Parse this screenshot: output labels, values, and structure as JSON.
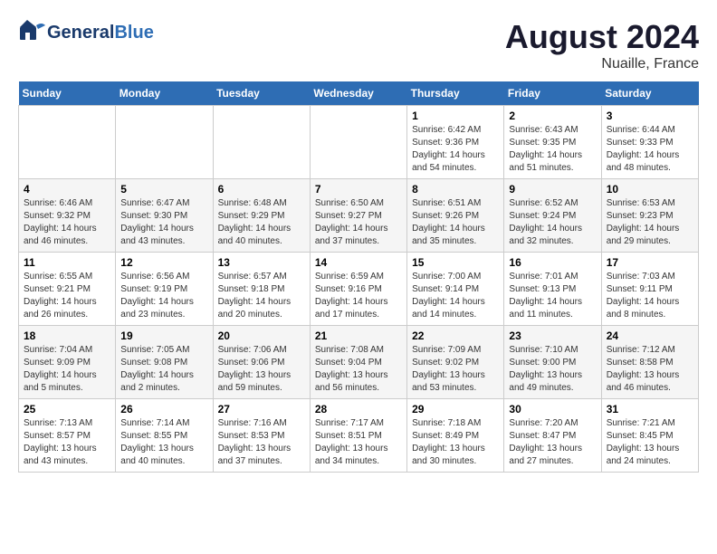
{
  "header": {
    "logo_line1": "General",
    "logo_line2": "Blue",
    "title": "August 2024",
    "location": "Nuaille, France"
  },
  "days_of_week": [
    "Sunday",
    "Monday",
    "Tuesday",
    "Wednesday",
    "Thursday",
    "Friday",
    "Saturday"
  ],
  "weeks": [
    [
      {
        "day": "",
        "info": ""
      },
      {
        "day": "",
        "info": ""
      },
      {
        "day": "",
        "info": ""
      },
      {
        "day": "",
        "info": ""
      },
      {
        "day": "1",
        "info": "Sunrise: 6:42 AM\nSunset: 9:36 PM\nDaylight: 14 hours\nand 54 minutes."
      },
      {
        "day": "2",
        "info": "Sunrise: 6:43 AM\nSunset: 9:35 PM\nDaylight: 14 hours\nand 51 minutes."
      },
      {
        "day": "3",
        "info": "Sunrise: 6:44 AM\nSunset: 9:33 PM\nDaylight: 14 hours\nand 48 minutes."
      }
    ],
    [
      {
        "day": "4",
        "info": "Sunrise: 6:46 AM\nSunset: 9:32 PM\nDaylight: 14 hours\nand 46 minutes."
      },
      {
        "day": "5",
        "info": "Sunrise: 6:47 AM\nSunset: 9:30 PM\nDaylight: 14 hours\nand 43 minutes."
      },
      {
        "day": "6",
        "info": "Sunrise: 6:48 AM\nSunset: 9:29 PM\nDaylight: 14 hours\nand 40 minutes."
      },
      {
        "day": "7",
        "info": "Sunrise: 6:50 AM\nSunset: 9:27 PM\nDaylight: 14 hours\nand 37 minutes."
      },
      {
        "day": "8",
        "info": "Sunrise: 6:51 AM\nSunset: 9:26 PM\nDaylight: 14 hours\nand 35 minutes."
      },
      {
        "day": "9",
        "info": "Sunrise: 6:52 AM\nSunset: 9:24 PM\nDaylight: 14 hours\nand 32 minutes."
      },
      {
        "day": "10",
        "info": "Sunrise: 6:53 AM\nSunset: 9:23 PM\nDaylight: 14 hours\nand 29 minutes."
      }
    ],
    [
      {
        "day": "11",
        "info": "Sunrise: 6:55 AM\nSunset: 9:21 PM\nDaylight: 14 hours\nand 26 minutes."
      },
      {
        "day": "12",
        "info": "Sunrise: 6:56 AM\nSunset: 9:19 PM\nDaylight: 14 hours\nand 23 minutes."
      },
      {
        "day": "13",
        "info": "Sunrise: 6:57 AM\nSunset: 9:18 PM\nDaylight: 14 hours\nand 20 minutes."
      },
      {
        "day": "14",
        "info": "Sunrise: 6:59 AM\nSunset: 9:16 PM\nDaylight: 14 hours\nand 17 minutes."
      },
      {
        "day": "15",
        "info": "Sunrise: 7:00 AM\nSunset: 9:14 PM\nDaylight: 14 hours\nand 14 minutes."
      },
      {
        "day": "16",
        "info": "Sunrise: 7:01 AM\nSunset: 9:13 PM\nDaylight: 14 hours\nand 11 minutes."
      },
      {
        "day": "17",
        "info": "Sunrise: 7:03 AM\nSunset: 9:11 PM\nDaylight: 14 hours\nand 8 minutes."
      }
    ],
    [
      {
        "day": "18",
        "info": "Sunrise: 7:04 AM\nSunset: 9:09 PM\nDaylight: 14 hours\nand 5 minutes."
      },
      {
        "day": "19",
        "info": "Sunrise: 7:05 AM\nSunset: 9:08 PM\nDaylight: 14 hours\nand 2 minutes."
      },
      {
        "day": "20",
        "info": "Sunrise: 7:06 AM\nSunset: 9:06 PM\nDaylight: 13 hours\nand 59 minutes."
      },
      {
        "day": "21",
        "info": "Sunrise: 7:08 AM\nSunset: 9:04 PM\nDaylight: 13 hours\nand 56 minutes."
      },
      {
        "day": "22",
        "info": "Sunrise: 7:09 AM\nSunset: 9:02 PM\nDaylight: 13 hours\nand 53 minutes."
      },
      {
        "day": "23",
        "info": "Sunrise: 7:10 AM\nSunset: 9:00 PM\nDaylight: 13 hours\nand 49 minutes."
      },
      {
        "day": "24",
        "info": "Sunrise: 7:12 AM\nSunset: 8:58 PM\nDaylight: 13 hours\nand 46 minutes."
      }
    ],
    [
      {
        "day": "25",
        "info": "Sunrise: 7:13 AM\nSunset: 8:57 PM\nDaylight: 13 hours\nand 43 minutes."
      },
      {
        "day": "26",
        "info": "Sunrise: 7:14 AM\nSunset: 8:55 PM\nDaylight: 13 hours\nand 40 minutes."
      },
      {
        "day": "27",
        "info": "Sunrise: 7:16 AM\nSunset: 8:53 PM\nDaylight: 13 hours\nand 37 minutes."
      },
      {
        "day": "28",
        "info": "Sunrise: 7:17 AM\nSunset: 8:51 PM\nDaylight: 13 hours\nand 34 minutes."
      },
      {
        "day": "29",
        "info": "Sunrise: 7:18 AM\nSunset: 8:49 PM\nDaylight: 13 hours\nand 30 minutes."
      },
      {
        "day": "30",
        "info": "Sunrise: 7:20 AM\nSunset: 8:47 PM\nDaylight: 13 hours\nand 27 minutes."
      },
      {
        "day": "31",
        "info": "Sunrise: 7:21 AM\nSunset: 8:45 PM\nDaylight: 13 hours\nand 24 minutes."
      }
    ]
  ]
}
